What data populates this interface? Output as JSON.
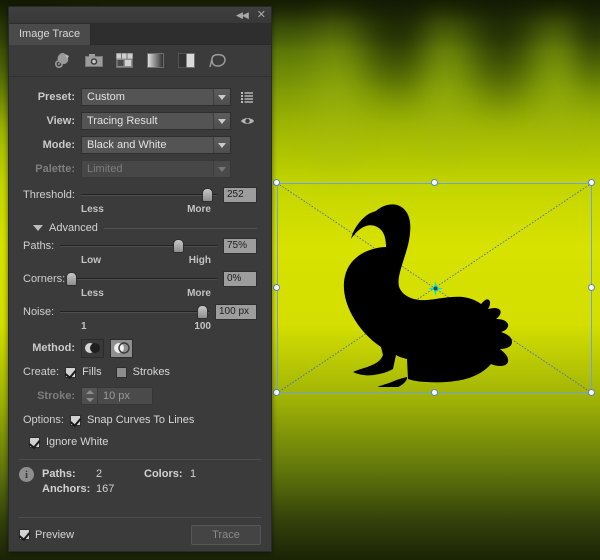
{
  "panel": {
    "header": {
      "collapse_icon": "collapse-double-left-icon",
      "close_icon": "close-icon"
    },
    "tab_label": "Image Trace",
    "toolbar": [
      {
        "name": "auto-color-icon",
        "title": "Auto-Color"
      },
      {
        "name": "high-color-photo-icon",
        "title": "High Color"
      },
      {
        "name": "low-color-icon",
        "title": "Low Color"
      },
      {
        "name": "grayscale-gradient-icon",
        "title": "Grayscale"
      },
      {
        "name": "black-and-white-icon",
        "title": "Black and White"
      },
      {
        "name": "outline-silhouette-icon",
        "title": "Outline"
      }
    ],
    "fields": {
      "preset": {
        "label": "Preset:",
        "value": "Custom",
        "menu_icon": "list-menu-icon"
      },
      "view": {
        "label": "View:",
        "value": "Tracing Result",
        "eye_icon": "eye-icon"
      },
      "mode": {
        "label": "Mode:",
        "value": "Black and White"
      },
      "palette": {
        "label": "Palette:",
        "value": "Limited",
        "disabled": true
      }
    },
    "threshold": {
      "label": "Threshold:",
      "value": "252",
      "percent": 93,
      "scale_min": "Less",
      "scale_max": "More"
    },
    "advanced": {
      "label": "Advanced",
      "expanded": true
    },
    "paths": {
      "label": "Paths:",
      "value": "75%",
      "percent": 75,
      "scale_min": "Low",
      "scale_max": "High"
    },
    "corners": {
      "label": "Corners:",
      "value": "0%",
      "percent": 0,
      "scale_min": "Less",
      "scale_max": "More"
    },
    "noise": {
      "label": "Noise:",
      "value": "100 px",
      "percent": 95,
      "scale_min": "1",
      "scale_max": "100"
    },
    "method": {
      "label": "Method:",
      "options": [
        {
          "name": "method-abutting-icon",
          "selected": false
        },
        {
          "name": "method-overlapping-icon",
          "selected": true
        }
      ]
    },
    "create": {
      "label": "Create:",
      "fills": {
        "text": "Fills",
        "checked": true
      },
      "strokes": {
        "text": "Strokes",
        "checked": false
      }
    },
    "stroke": {
      "label": "Stroke:",
      "value": "10 px",
      "disabled": true
    },
    "options": {
      "label": "Options:",
      "snap_curves": {
        "text": "Snap Curves To Lines",
        "checked": true
      },
      "ignore_white": {
        "text": "Ignore White",
        "checked": true
      }
    },
    "info": {
      "icon": "info-circle-icon",
      "paths_key": "Paths:",
      "paths_value": "2",
      "colors_key": "Colors:",
      "colors_value": "1",
      "anchors_key": "Anchors:",
      "anchors_value": "167"
    },
    "footer": {
      "preview": {
        "text": "Preview",
        "checked": true
      },
      "trace_button": "Trace"
    }
  },
  "canvas": {
    "selection": {
      "handle_count": 8,
      "center_anchor": "center-anchor-icon",
      "frame_color": "#6e9fe8",
      "anchor_color": "#00e5e5"
    },
    "artwork": {
      "name": "goose-silhouette",
      "fill_color": "#000000"
    },
    "background": {
      "top_color": "#1d2704",
      "mid_color": "#d8e200",
      "bottom_color": "#1b2306"
    }
  }
}
